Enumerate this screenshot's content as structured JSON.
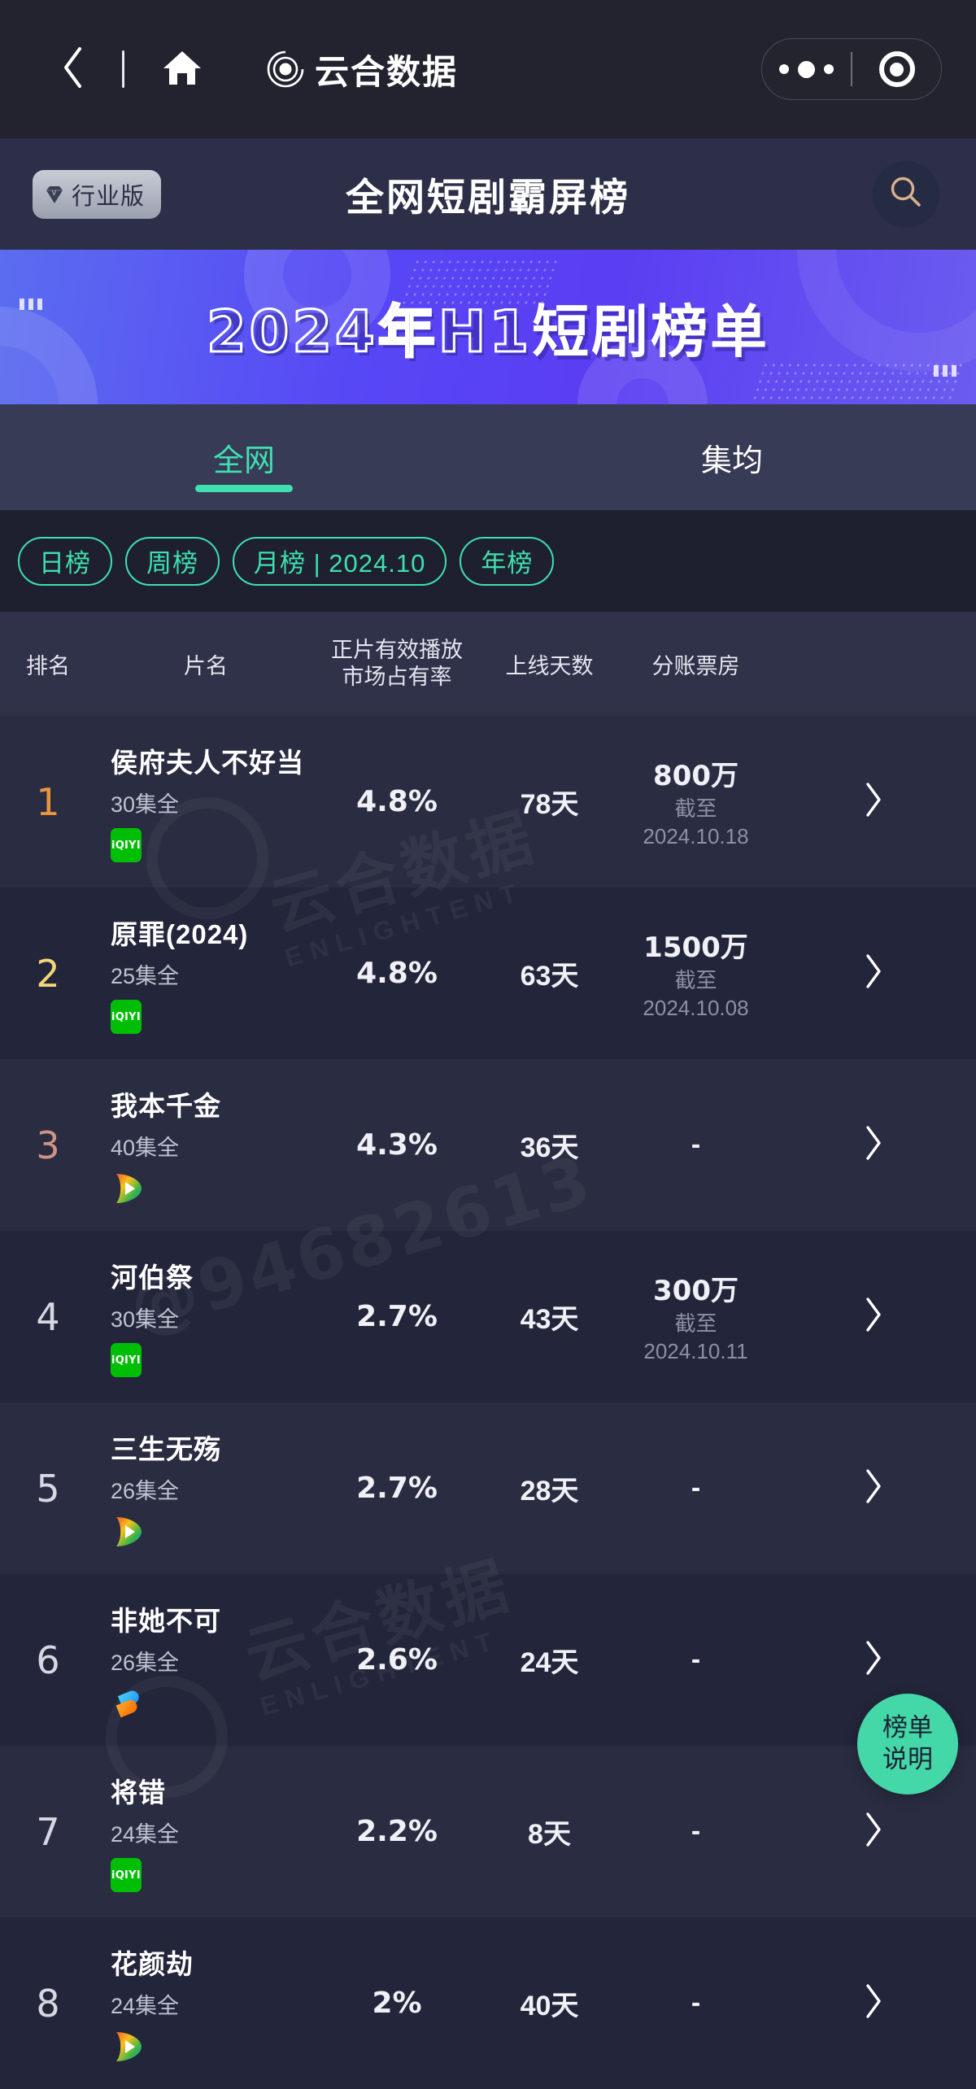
{
  "navbar": {
    "back_icon": "chevron-left-icon",
    "home_icon": "home-icon",
    "brand_logo_icon": "enlightent-logo-icon",
    "brand_text": "云合数据",
    "capsule": {
      "more_icon": "more-dots-icon",
      "target_icon": "target-circle-icon"
    }
  },
  "header": {
    "vip_badge": "行业版",
    "vip_badge_icon": "diamond-icon",
    "title": "全网短剧霸屏榜",
    "search_icon": "search-icon"
  },
  "banner": {
    "title_outline": "2024年H1",
    "title_solid": "短剧榜单"
  },
  "tabs": [
    {
      "label": "全网",
      "active": true
    },
    {
      "label": "集均",
      "active": false
    }
  ],
  "chips": [
    {
      "label": "日榜"
    },
    {
      "label": "周榜"
    },
    {
      "label": "月榜 | 2024.10"
    },
    {
      "label": "年榜"
    }
  ],
  "table": {
    "headers": {
      "rank": "排名",
      "title": "片名",
      "share_line1": "正片有效播放",
      "share_line2": "市场占有率",
      "days": "上线天数",
      "box": "分账票房"
    },
    "rows": [
      {
        "rank": "1",
        "rank_color": "#e8963c",
        "title": "侯府夫人不好当",
        "episodes": "30集全",
        "platform": "iqiyi",
        "platform_label": "iQIYI",
        "share": "4.8%",
        "days": "78天",
        "box": "800万",
        "box_sub": "截至\n2024.10.18",
        "arrow_icon": "chevron-right-icon"
      },
      {
        "rank": "2",
        "rank_color": "#f2d676",
        "title": "原罪(2024)",
        "episodes": "25集全",
        "platform": "iqiyi",
        "platform_label": "iQIYI",
        "share": "4.8%",
        "days": "63天",
        "box": "1500万",
        "box_sub": "截至\n2024.10.08",
        "arrow_icon": "chevron-right-icon"
      },
      {
        "rank": "3",
        "rank_color": "#cf9382",
        "title": "我本千金",
        "episodes": "40集全",
        "platform": "mango",
        "platform_label": "芒果TV",
        "share": "4.3%",
        "days": "36天",
        "box": "-",
        "box_sub": "",
        "arrow_icon": "chevron-right-icon"
      },
      {
        "rank": "4",
        "rank_color": "#d5d7e2",
        "title": "河伯祭",
        "episodes": "30集全",
        "platform": "iqiyi",
        "platform_label": "iQIYI",
        "share": "2.7%",
        "days": "43天",
        "box": "300万",
        "box_sub": "截至\n2024.10.11",
        "arrow_icon": "chevron-right-icon"
      },
      {
        "rank": "5",
        "rank_color": "#d5d7e2",
        "title": "三生无殇",
        "episodes": "26集全",
        "platform": "mango",
        "platform_label": "芒果TV",
        "share": "2.7%",
        "days": "28天",
        "box": "-",
        "box_sub": "",
        "arrow_icon": "chevron-right-icon"
      },
      {
        "rank": "6",
        "rank_color": "#d5d7e2",
        "title": "非她不可",
        "episodes": "26集全",
        "platform": "douyin",
        "platform_label": "抖音",
        "share": "2.6%",
        "days": "24天",
        "box": "-",
        "box_sub": "",
        "arrow_icon": "chevron-right-icon"
      },
      {
        "rank": "7",
        "rank_color": "#d5d7e2",
        "title": "将错",
        "episodes": "24集全",
        "platform": "iqiyi",
        "platform_label": "iQIYI",
        "share": "2.2%",
        "days": "8天",
        "box": "-",
        "box_sub": "",
        "arrow_icon": "chevron-right-icon"
      },
      {
        "rank": "8",
        "rank_color": "#d5d7e2",
        "title": "花颜劫",
        "episodes": "24集全",
        "platform": "mango",
        "platform_label": "芒果TV",
        "share": "2%",
        "days": "40天",
        "box": "-",
        "box_sub": "",
        "arrow_icon": "chevron-right-icon"
      }
    ]
  },
  "fab": {
    "line1": "榜单",
    "line2": "说明"
  },
  "watermarks": {
    "brand_cn": "云合数据",
    "brand_en": "ENLIGHTENT",
    "account": "@94682613"
  },
  "colors": {
    "accent_green": "#3fe0b0",
    "fab_green": "#44d7a8",
    "banner_blue": "#5747f5",
    "iqiyi_green": "#00be06",
    "rank1": "#e8963c",
    "rank2": "#f2d676",
    "rank3": "#cf9382"
  }
}
